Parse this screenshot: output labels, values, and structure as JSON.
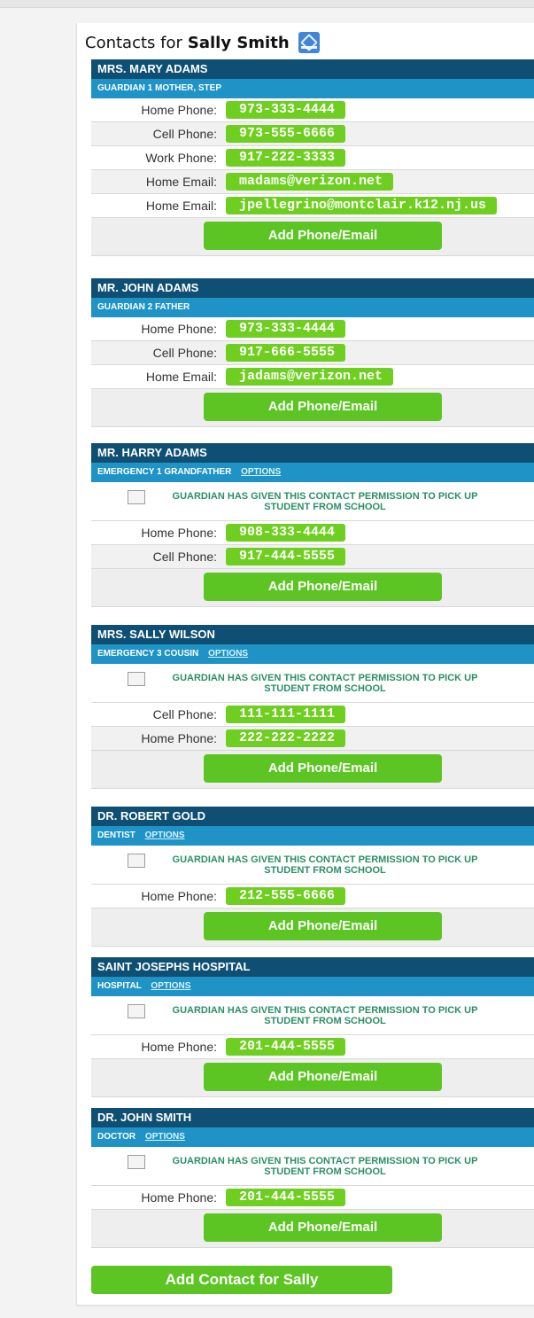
{
  "header": {
    "prefix": "Contacts for ",
    "student": "Sally Smith"
  },
  "contacts": [
    {
      "name": "MRS. MARY ADAMS",
      "role": "GUARDIAN 1  MOTHER, STEP",
      "options": "",
      "permission": "",
      "rows": [
        {
          "label": "Home Phone:",
          "value": "973-333-4444"
        },
        {
          "label": "Cell Phone:",
          "value": "973-555-6666"
        },
        {
          "label": "Work Phone:",
          "value": "917-222-3333"
        },
        {
          "label": "Home Email:",
          "value": "madams@verizon.net"
        },
        {
          "label": "Home Email:",
          "value": "jpellegrino@montclair.k12.nj.us"
        }
      ],
      "add_label": "Add Phone/Email"
    },
    {
      "name": "MR. JOHN ADAMS",
      "role": "GUARDIAN 2  FATHER",
      "options": "",
      "permission": "",
      "rows": [
        {
          "label": "Home Phone:",
          "value": "973-333-4444"
        },
        {
          "label": "Cell Phone:",
          "value": "917-666-5555"
        },
        {
          "label": "Home Email:",
          "value": "jadams@verizon.net"
        }
      ],
      "add_label": "Add Phone/Email"
    },
    {
      "name": "MR. HARRY ADAMS",
      "role": "EMERGENCY 1  GRANDFATHER",
      "options": "OPTIONS",
      "permission": "GUARDIAN HAS GIVEN THIS CONTACT PERMISSION TO PICK UP STUDENT FROM SCHOOL",
      "rows": [
        {
          "label": "Home Phone:",
          "value": "908-333-4444"
        },
        {
          "label": "Cell Phone:",
          "value": "917-444-5555"
        }
      ],
      "add_label": "Add Phone/Email"
    },
    {
      "name": "MRS. SALLY WILSON",
      "role": "EMERGENCY 3  COUSIN",
      "options": "OPTIONS",
      "permission": "GUARDIAN HAS GIVEN THIS CONTACT PERMISSION TO PICK UP STUDENT FROM SCHOOL",
      "rows": [
        {
          "label": "Cell Phone:",
          "value": "111-111-1111"
        },
        {
          "label": "Home Phone:",
          "value": "222-222-2222"
        }
      ],
      "add_label": "Add Phone/Email"
    },
    {
      "name": "DR. ROBERT GOLD",
      "role": "DENTIST",
      "options": "OPTIONS",
      "permission": "GUARDIAN HAS GIVEN THIS CONTACT PERMISSION TO PICK UP STUDENT FROM SCHOOL",
      "rows": [
        {
          "label": "Home Phone:",
          "value": "212-555-6666"
        }
      ],
      "add_label": "Add Phone/Email"
    },
    {
      "name": "SAINT JOSEPHS HOSPITAL",
      "role": "HOSPITAL",
      "options": "OPTIONS",
      "permission": "GUARDIAN HAS GIVEN THIS CONTACT PERMISSION TO PICK UP STUDENT FROM SCHOOL",
      "rows": [
        {
          "label": "Home Phone:",
          "value": "201-444-5555"
        }
      ],
      "add_label": "Add Phone/Email"
    },
    {
      "name": "DR. JOHN SMITH",
      "role": "DOCTOR",
      "options": "OPTIONS",
      "permission": "GUARDIAN HAS GIVEN THIS CONTACT PERMISSION TO PICK UP STUDENT FROM SCHOOL",
      "rows": [
        {
          "label": "Home Phone:",
          "value": "201-444-5555"
        }
      ],
      "add_label": "Add Phone/Email"
    }
  ],
  "footer": {
    "add_contact_label": "Add Contact for Sally"
  },
  "icons": {
    "pdf": "pdf-icon"
  },
  "colors": {
    "header_dark": "#0f4f73",
    "header_light": "#1f93c6",
    "green": "#5cc523"
  }
}
